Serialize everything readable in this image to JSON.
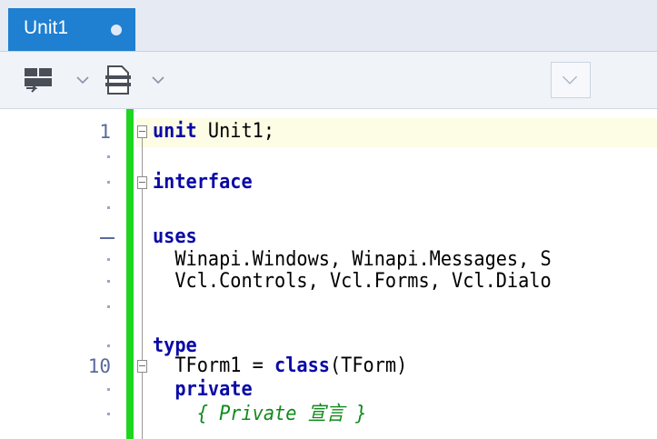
{
  "tab": {
    "label": "Unit1"
  },
  "toolbar": {
    "buttons": [
      {
        "icon": "layout-icon"
      },
      {
        "icon": "document-icon"
      }
    ]
  },
  "editor": {
    "colors": {
      "keyword": "#0a0aa6",
      "comment": "#0e8a19",
      "modified_bar": "#1ed61e",
      "current_line": "#fdfde6"
    },
    "lines": [
      {
        "number": "1",
        "kw": "unit",
        "text": " Unit1;"
      },
      {
        "number": "",
        "kw": "",
        "text": ""
      },
      {
        "number": "",
        "kw": "interface",
        "text": ""
      },
      {
        "number": "",
        "kw": "",
        "text": ""
      },
      {
        "number": "",
        "kw": "uses",
        "text": ""
      },
      {
        "number": "",
        "kw": "",
        "text": "  Winapi.Windows, Winapi.Messages, S"
      },
      {
        "number": "",
        "kw": "",
        "text": "  Vcl.Controls, Vcl.Forms, Vcl.Dialo"
      },
      {
        "number": "",
        "kw": "",
        "text": ""
      },
      {
        "number": "",
        "kw": "type",
        "text": ""
      },
      {
        "number": "10",
        "pre": "  TForm1 = ",
        "kw": "class",
        "text": "(TForm)"
      },
      {
        "number": "",
        "pre": "  ",
        "kw": "private",
        "text": ""
      },
      {
        "number": "",
        "comment": "    { Private 宣言 }"
      }
    ]
  }
}
